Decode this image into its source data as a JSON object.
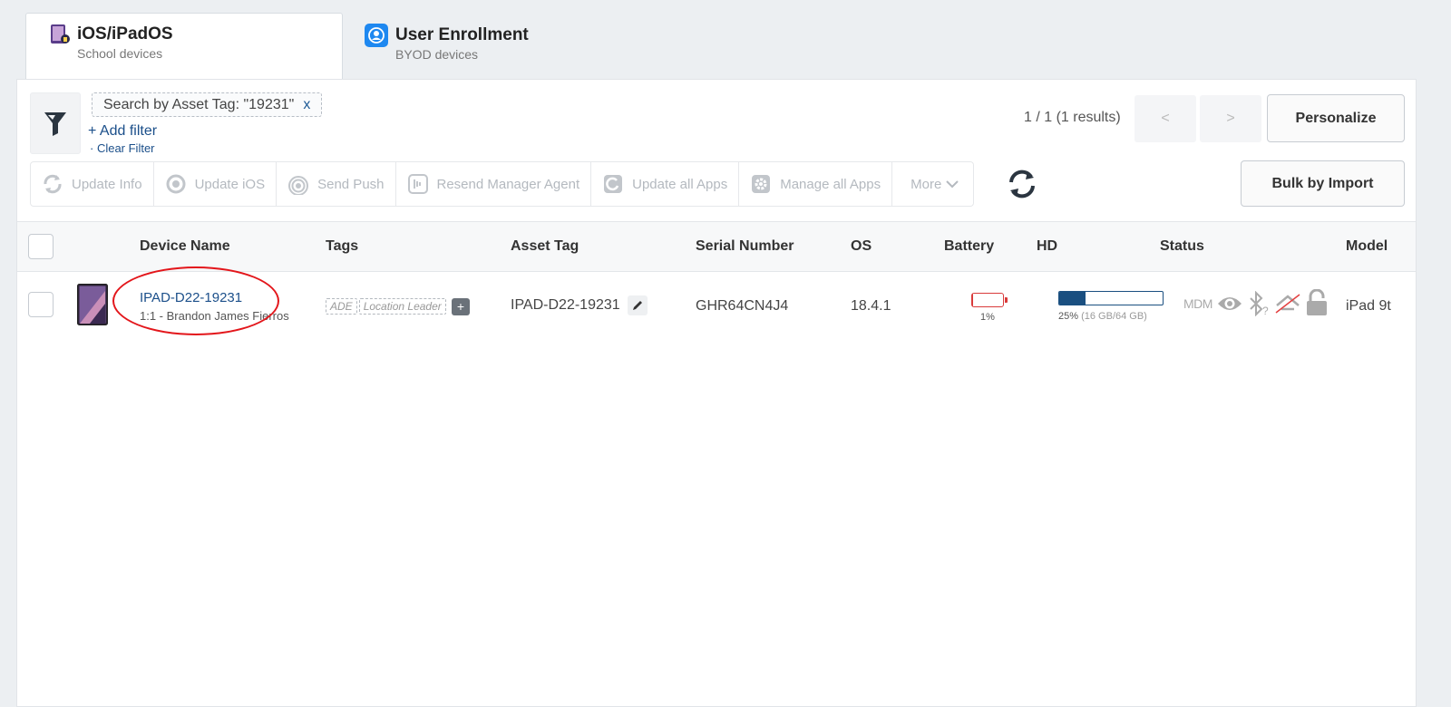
{
  "tabs": [
    {
      "title": "iOS/iPadOS",
      "subtitle": "School devices"
    },
    {
      "title": "User Enrollment",
      "subtitle": "BYOD devices"
    }
  ],
  "filter": {
    "chip_label": "Search by Asset Tag: \"19231\"",
    "chip_remove": "x",
    "add_filter": "+ Add filter",
    "clear_filter": "· Clear Filter"
  },
  "pagination": {
    "results": "1 / 1 (1 results)",
    "prev": "<",
    "next": ">"
  },
  "buttons": {
    "personalize": "Personalize",
    "bulk_import": "Bulk by Import"
  },
  "toolbar": {
    "update_info": "Update Info",
    "update_ios": "Update iOS",
    "send_push": "Send Push",
    "resend_agent": "Resend Manager Agent",
    "update_apps": "Update all Apps",
    "manage_apps": "Manage all Apps",
    "more": "More"
  },
  "table": {
    "headers": {
      "device_name": "Device Name",
      "tags": "Tags",
      "asset_tag": "Asset Tag",
      "serial": "Serial Number",
      "os": "OS",
      "battery": "Battery",
      "hd": "HD",
      "status": "Status",
      "model": "Model"
    },
    "rows": [
      {
        "device_name": "IPAD-D22-19231",
        "owner": "1:1 - Brandon James Fierros",
        "tags": [
          "ADE",
          "Location Leader"
        ],
        "tag_add": "+",
        "asset_tag": "IPAD-D22-19231",
        "serial": "GHR64CN4J4",
        "os": "18.4.1",
        "battery_pct": 0.01,
        "battery_label": "1%",
        "hd_fraction": 0.25,
        "hd_pct": "25%",
        "hd_detail": "(16 GB/64 GB)",
        "status_mdm": "MDM",
        "model": "iPad 9t"
      }
    ]
  },
  "icons": [
    "ios-device-icon",
    "user-enrollment-icon",
    "filter-funnel-icon",
    "refresh-icon",
    "eye-icon",
    "bluetooth-unknown-icon",
    "airplay-off-icon",
    "lock-open-icon",
    "pencil-icon",
    "chevron-down-icon"
  ],
  "colors": {
    "link": "#1b4f8a",
    "battery_low": "#d93b3b",
    "hd_bar": "#1a4f80",
    "annotation": "#e3161b",
    "user_enrollment_icon": "#1e88f0"
  }
}
